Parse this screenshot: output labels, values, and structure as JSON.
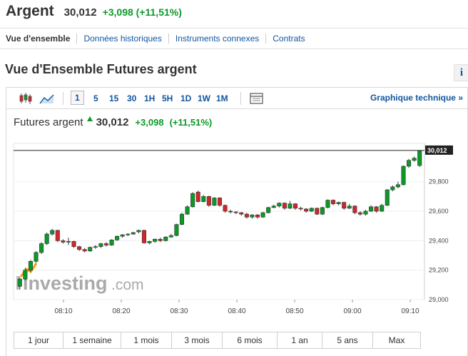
{
  "header": {
    "name": "Argent",
    "price": "30,012",
    "change": "+3,098 (+11,51%)"
  },
  "subnav": [
    "Vue d'ensemble",
    "Données historiques",
    "Instruments connexes",
    "Contrats"
  ],
  "section_title": "Vue d'Ensemble Futures argent",
  "info_icon_label": "i",
  "toolbar": {
    "timeframes": [
      "1",
      "5",
      "15",
      "30",
      "1H",
      "5H",
      "1D",
      "1W",
      "1M"
    ],
    "active_timeframe": "1",
    "tech_link": "Graphique technique »"
  },
  "quote": {
    "name": "Futures argent",
    "price": "30,012",
    "change": "+3,098",
    "pct": "(+11,51%)"
  },
  "watermark": {
    "brand": "Investing",
    "suffix": ".com"
  },
  "ranges": [
    "1 jour",
    "1 semaine",
    "1 mois",
    "3 mois",
    "6 mois",
    "1 an",
    "5 ans",
    "Max"
  ],
  "colors": {
    "up": "#0a9a27",
    "down": "#d1262b",
    "link": "#1256a0"
  },
  "chart_data": {
    "type": "candlestick",
    "ylim": [
      29000,
      30060
    ],
    "y_ticks": [
      29000,
      29200,
      29400,
      29600,
      29800
    ],
    "y_tick_labels": [
      "29,000",
      "29,200",
      "29,400",
      "29,600",
      "29,800"
    ],
    "x_ticks": [
      "08:10",
      "08:20",
      "08:30",
      "08:40",
      "08:50",
      "09:00",
      "09:10"
    ],
    "last_price_label": "30,012",
    "last_price": 30012,
    "candles": [
      [
        29090,
        29140,
        29070,
        29150
      ],
      [
        29140,
        29200,
        29130,
        29215
      ],
      [
        29200,
        29260,
        29190,
        29270
      ],
      [
        29260,
        29320,
        29250,
        29330
      ],
      [
        29320,
        29380,
        29310,
        29390
      ],
      [
        29380,
        29445,
        29370,
        29455
      ],
      [
        29445,
        29470,
        29435,
        29480
      ],
      [
        29470,
        29400,
        29390,
        29475
      ],
      [
        29400,
        29390,
        29380,
        29410
      ],
      [
        29390,
        29395,
        29370,
        29420
      ],
      [
        29395,
        29360,
        29350,
        29400
      ],
      [
        29360,
        29340,
        29330,
        29365
      ],
      [
        29340,
        29330,
        29320,
        29350
      ],
      [
        29330,
        29355,
        29325,
        29360
      ],
      [
        29355,
        29360,
        29345,
        29370
      ],
      [
        29360,
        29380,
        29350,
        29385
      ],
      [
        29380,
        29370,
        29360,
        29390
      ],
      [
        29370,
        29405,
        29365,
        29410
      ],
      [
        29405,
        29430,
        29400,
        29435
      ],
      [
        29430,
        29440,
        29420,
        29445
      ],
      [
        29440,
        29445,
        29430,
        29450
      ],
      [
        29445,
        29455,
        29440,
        29460
      ],
      [
        29460,
        29470,
        29450,
        29475
      ],
      [
        29470,
        29385,
        29380,
        29475
      ],
      [
        29385,
        29395,
        29375,
        29400
      ],
      [
        29395,
        29410,
        29385,
        29415
      ],
      [
        29410,
        29400,
        29390,
        29420
      ],
      [
        29400,
        29425,
        29395,
        29430
      ],
      [
        29425,
        29435,
        29420,
        29445
      ],
      [
        29435,
        29510,
        29430,
        29515
      ],
      [
        29510,
        29580,
        29505,
        29590
      ],
      [
        29580,
        29630,
        29575,
        29640
      ],
      [
        29630,
        29720,
        29625,
        29730
      ],
      [
        29730,
        29665,
        29660,
        29740
      ],
      [
        29665,
        29700,
        29660,
        29710
      ],
      [
        29700,
        29640,
        29630,
        29705
      ],
      [
        29640,
        29690,
        29635,
        29695
      ],
      [
        29690,
        29640,
        29630,
        29695
      ],
      [
        29640,
        29600,
        29590,
        29645
      ],
      [
        29600,
        29595,
        29585,
        29610
      ],
      [
        29595,
        29590,
        29580,
        29600
      ],
      [
        29590,
        29580,
        29570,
        29595
      ],
      [
        29580,
        29560,
        29550,
        29590
      ],
      [
        29560,
        29575,
        29550,
        29580
      ],
      [
        29575,
        29560,
        29550,
        29580
      ],
      [
        29560,
        29590,
        29555,
        29595
      ],
      [
        29590,
        29625,
        29585,
        29630
      ],
      [
        29625,
        29635,
        29620,
        29645
      ],
      [
        29635,
        29655,
        29625,
        29660
      ],
      [
        29655,
        29620,
        29610,
        29660
      ],
      [
        29620,
        29650,
        29615,
        29670
      ],
      [
        29650,
        29620,
        29610,
        29655
      ],
      [
        29620,
        29615,
        29605,
        29630
      ],
      [
        29615,
        29600,
        29590,
        29620
      ],
      [
        29600,
        29620,
        29595,
        29625
      ],
      [
        29620,
        29580,
        29575,
        29625
      ],
      [
        29580,
        29625,
        29575,
        29630
      ],
      [
        29625,
        29675,
        29620,
        29680
      ],
      [
        29675,
        29650,
        29640,
        29680
      ],
      [
        29650,
        29660,
        29640,
        29665
      ],
      [
        29660,
        29620,
        29610,
        29665
      ],
      [
        29620,
        29635,
        29615,
        29650
      ],
      [
        29635,
        29590,
        29580,
        29640
      ],
      [
        29590,
        29580,
        29570,
        29600
      ],
      [
        29580,
        29600,
        29570,
        29610
      ],
      [
        29600,
        29630,
        29595,
        29640
      ],
      [
        29630,
        29600,
        29590,
        29635
      ],
      [
        29600,
        29640,
        29595,
        29650
      ],
      [
        29640,
        29745,
        29635,
        29750
      ],
      [
        29745,
        29765,
        29735,
        29775
      ],
      [
        29765,
        29780,
        29755,
        29800
      ],
      [
        29780,
        29905,
        29775,
        29910
      ],
      [
        29905,
        29945,
        29895,
        29955
      ],
      [
        29945,
        29960,
        29935,
        29970
      ],
      [
        29910,
        30012,
        29900,
        30015
      ]
    ]
  }
}
